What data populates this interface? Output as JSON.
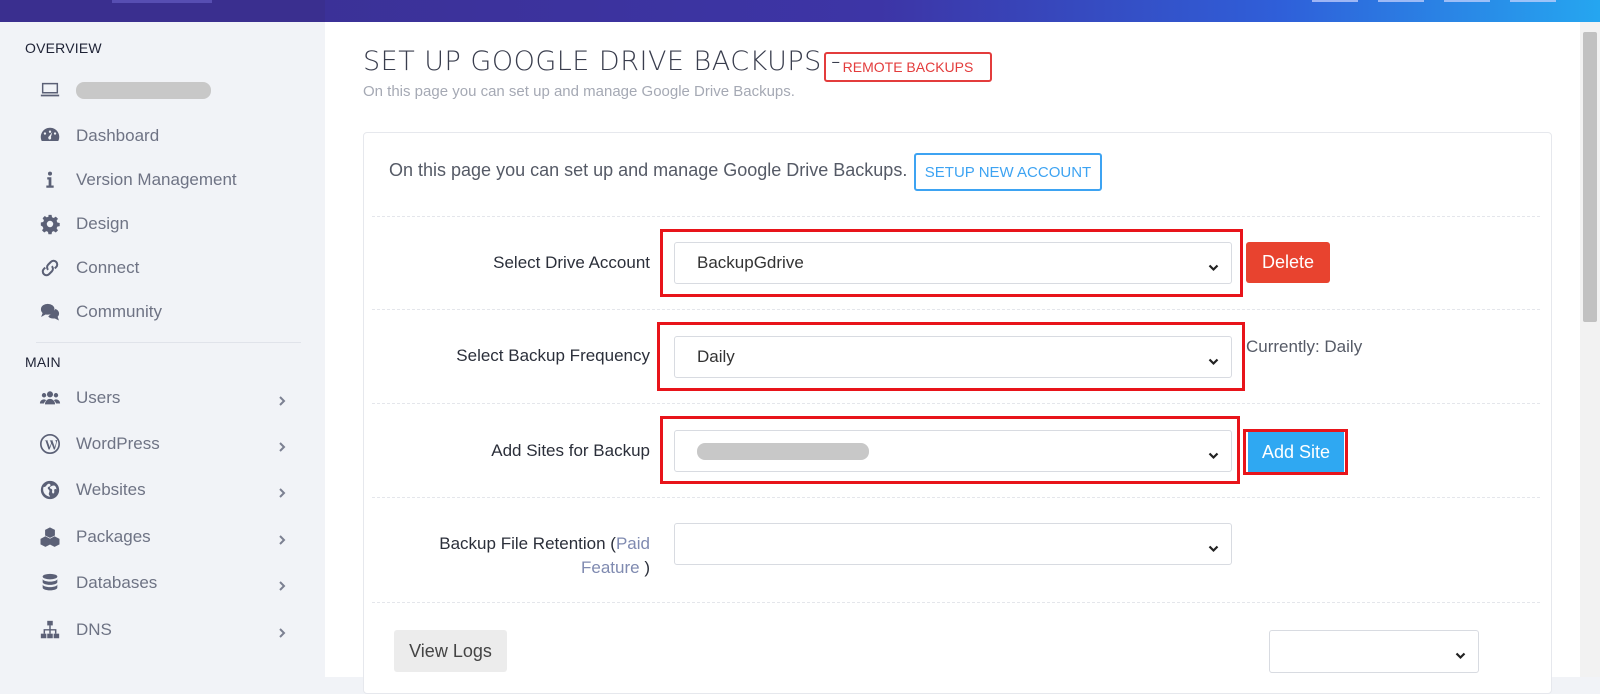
{
  "sidebar": {
    "overview_heading": "OVERVIEW",
    "main_heading": "MAIN",
    "overview_items": [
      {
        "label": "Dashboard",
        "icon": "dashboard-icon"
      },
      {
        "label": "Version Management",
        "icon": "info-icon"
      },
      {
        "label": "Design",
        "icon": "gear-icon"
      },
      {
        "label": "Connect",
        "icon": "link-icon"
      },
      {
        "label": "Community",
        "icon": "comments-icon"
      }
    ],
    "main_items": [
      {
        "label": "Users",
        "icon": "users-icon"
      },
      {
        "label": "WordPress",
        "icon": "wordpress-icon"
      },
      {
        "label": "Websites",
        "icon": "globe-icon"
      },
      {
        "label": "Packages",
        "icon": "cubes-icon"
      },
      {
        "label": "Databases",
        "icon": "database-icon"
      },
      {
        "label": "DNS",
        "icon": "sitemap-icon"
      }
    ]
  },
  "page": {
    "title": "SET UP GOOGLE DRIVE BACKUPS -",
    "badge": "REMOTE BACKUPS",
    "subtitle": "On this page you can set up and manage Google Drive Backups."
  },
  "card": {
    "intro": "On this page you can set up and manage Google Drive Backups.",
    "setup_button": "SETUP NEW ACCOUNT",
    "drive_account": {
      "label": "Select Drive Account",
      "value": "BackupGdrive",
      "delete_label": "Delete"
    },
    "frequency": {
      "label": "Select Backup Frequency",
      "value": "Daily",
      "current": "Currently: Daily"
    },
    "sites": {
      "label": "Add Sites for Backup",
      "add_label": "Add Site"
    },
    "retention": {
      "label_prefix": "Backup File Retention (",
      "paid_text": "Paid Feature",
      "label_suffix": " )"
    },
    "logs_button": "View Logs"
  },
  "colors": {
    "accent": "#2fa8f2",
    "danger": "#e8432f",
    "highlight_box": "#e8141a",
    "topbar": "#3a2f8f"
  }
}
